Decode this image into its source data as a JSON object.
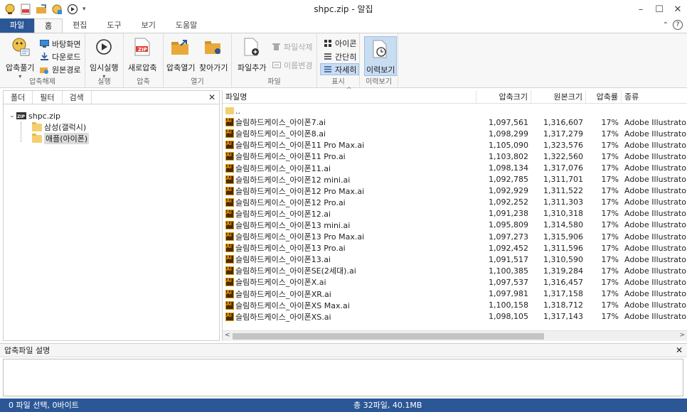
{
  "window": {
    "title": "shpc.zip - 알집"
  },
  "ribbon_tabs": [
    "파일",
    "홈",
    "편집",
    "도구",
    "보기",
    "도움말"
  ],
  "ribbon": {
    "extract": {
      "label": "압축풀기",
      "group": "압축해제"
    },
    "desktop": "바탕화면",
    "downloads": "다운로드",
    "original_path": "원본경로",
    "temp_run": {
      "label": "임시실행",
      "group": "실행"
    },
    "new_zip": {
      "label": "새로압축",
      "group": "압축"
    },
    "open_archive": "압축열기",
    "browse": "찾아가기",
    "open_group": "열기",
    "add_file": "파일추가",
    "delete_file": "파일삭제",
    "rename": "이름변경",
    "file_group": "파일",
    "view_icon": "아이콘",
    "view_simple": "간단히",
    "view_detail": "자세히",
    "view_group": "표시",
    "history": {
      "label": "이력보기",
      "group": "이력보기"
    }
  },
  "left_panel": {
    "tabs": [
      "폴더",
      "필터",
      "검색"
    ],
    "tree": {
      "root": "shpc.zip",
      "children": [
        "삼성(갤럭시)",
        "애플(아이폰)"
      ],
      "selected": "애플(아이폰)"
    }
  },
  "file_list": {
    "columns": [
      "파일명",
      "압축크기",
      "원본크기",
      "압축률",
      "종류"
    ],
    "parent": "..",
    "rows": [
      [
        "슬림하드케이스_아이폰7.ai",
        "1,097,561",
        "1,316,607",
        "17%",
        "Adobe Illustrator ..."
      ],
      [
        "슬림하드케이스_아이폰8.ai",
        "1,098,299",
        "1,317,279",
        "17%",
        "Adobe Illustrator ..."
      ],
      [
        "슬림하드케이스_아이폰11 Pro Max.ai",
        "1,105,090",
        "1,323,576",
        "17%",
        "Adobe Illustrator ..."
      ],
      [
        "슬림하드케이스_아이폰11 Pro.ai",
        "1,103,802",
        "1,322,560",
        "17%",
        "Adobe Illustrator ..."
      ],
      [
        "슬림하드케이스_아이폰11.ai",
        "1,098,134",
        "1,317,076",
        "17%",
        "Adobe Illustrator ..."
      ],
      [
        "슬림하드케이스_아이폰12 mini.ai",
        "1,092,785",
        "1,311,701",
        "17%",
        "Adobe Illustrator ..."
      ],
      [
        "슬림하드케이스_아이폰12 Pro Max.ai",
        "1,092,929",
        "1,311,522",
        "17%",
        "Adobe Illustrator ..."
      ],
      [
        "슬림하드케이스_아이폰12 Pro.ai",
        "1,092,252",
        "1,311,303",
        "17%",
        "Adobe Illustrator ..."
      ],
      [
        "슬림하드케이스_아이폰12.ai",
        "1,091,238",
        "1,310,318",
        "17%",
        "Adobe Illustrator ..."
      ],
      [
        "슬림하드케이스_아이폰13 mini.ai",
        "1,095,809",
        "1,314,580",
        "17%",
        "Adobe Illustrator ..."
      ],
      [
        "슬림하드케이스_아이폰13 Pro Max.ai",
        "1,097,273",
        "1,315,906",
        "17%",
        "Adobe Illustrator ..."
      ],
      [
        "슬림하드케이스_아이폰13 Pro.ai",
        "1,092,452",
        "1,311,596",
        "17%",
        "Adobe Illustrator ..."
      ],
      [
        "슬림하드케이스_아이폰13.ai",
        "1,091,517",
        "1,310,590",
        "17%",
        "Adobe Illustrator ..."
      ],
      [
        "슬림하드케이스_아이폰SE(2세대).ai",
        "1,100,385",
        "1,319,284",
        "17%",
        "Adobe Illustrator ..."
      ],
      [
        "슬림하드케이스_아이폰X.ai",
        "1,097,537",
        "1,316,457",
        "17%",
        "Adobe Illustrator ..."
      ],
      [
        "슬림하드케이스_아이폰XR.ai",
        "1,097,981",
        "1,317,158",
        "17%",
        "Adobe Illustrator ..."
      ],
      [
        "슬림하드케이스_아이폰XS Max.ai",
        "1,100,158",
        "1,318,712",
        "17%",
        "Adobe Illustrator ..."
      ],
      [
        "슬림하드케이스_아이폰XS.ai",
        "1,098,105",
        "1,317,143",
        "17%",
        "Adobe Illustrator ..."
      ]
    ]
  },
  "description_panel": {
    "title": "압축파일 설명"
  },
  "status": {
    "selection": "0 파일 선택,  0바이트",
    "total": "총 32파일,  40.1MB"
  }
}
